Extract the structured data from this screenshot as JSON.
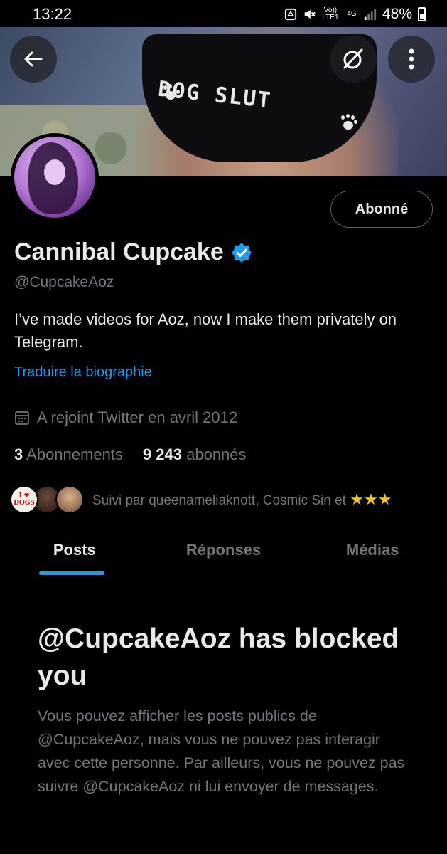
{
  "status_bar": {
    "time": "13:22",
    "volte_label": "Vo)) LTE1",
    "network_label": "4G",
    "battery": "48%"
  },
  "banner": {
    "garment_text": "DOG SLUT"
  },
  "header_buttons": {
    "back_icon": "arrow-left-icon",
    "grok_icon": "grok-icon",
    "more_icon": "more-vertical-icon"
  },
  "profile": {
    "display_name": "Cannibal Cupcake",
    "handle": "@CupcakeAoz",
    "bio": "I’ve made videos for Aoz, now I make them privately on Telegram.",
    "translate_label": "Traduire la biographie",
    "joined": "A rejoint Twitter en avril 2012",
    "following_count": "3",
    "following_label": "Abonnements",
    "followers_count": "9 243",
    "followers_label": "abonnés",
    "followed_by": "Suivi par queenameliaknott, Cosmic Sin et",
    "followed_by_stars": "★★★",
    "follow_button": "Abonné",
    "mini_avatar_a_text": "I ❤ DOGS"
  },
  "tabs": [
    {
      "label": "Posts",
      "active": true
    },
    {
      "label": "Réponses",
      "active": false
    },
    {
      "label": "Médias",
      "active": false
    }
  ],
  "blocked": {
    "title": "@CupcakeAoz has blocked you",
    "description": "Vous pouvez afficher les posts publics de @CupcakeAoz, mais vous ne pouvez pas interagir avec cette personne. Par ailleurs, vous ne pouvez pas suivre @CupcakeAoz ni lui envoyer de messages."
  },
  "colors": {
    "accent": "#1d9bf0",
    "secondary_text": "#71767b",
    "primary_text": "#e7e9ea",
    "border": "#2f3336"
  }
}
